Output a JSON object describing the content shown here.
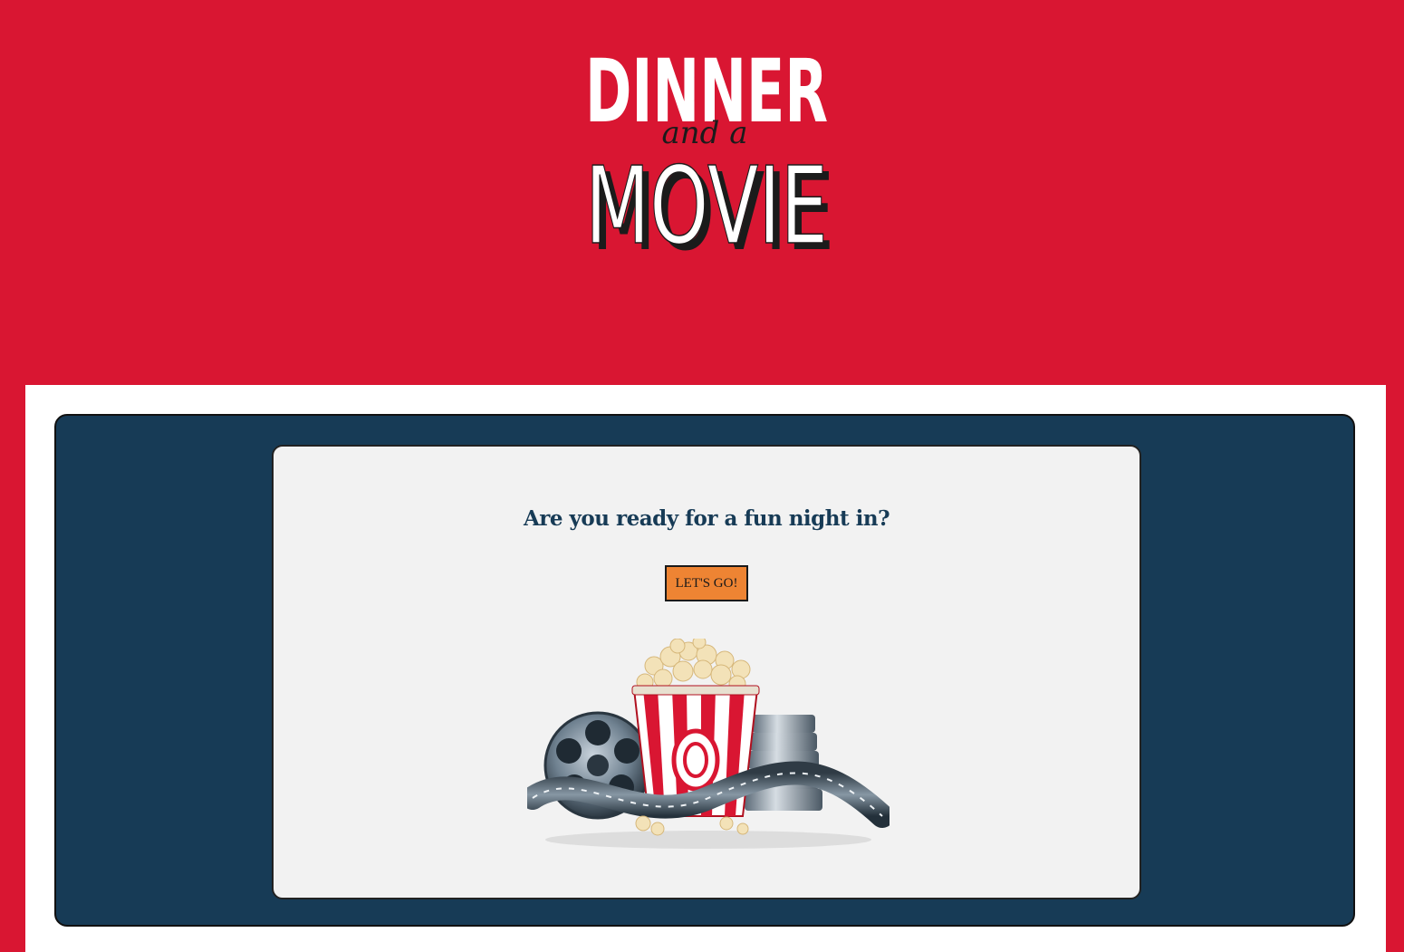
{
  "header": {
    "logo": {
      "line1": "DINNER",
      "line2": "and a",
      "line3": "MOVIE"
    }
  },
  "main": {
    "question": "Are you ready for a fun night in?",
    "button_label": "LET'S GO!",
    "illustration_icon": "popcorn-film-reel-icon"
  },
  "colors": {
    "brand_red": "#d91632",
    "navy": "#173b56",
    "card_bg": "#f2f2f2",
    "button_orange": "#ee8433"
  }
}
